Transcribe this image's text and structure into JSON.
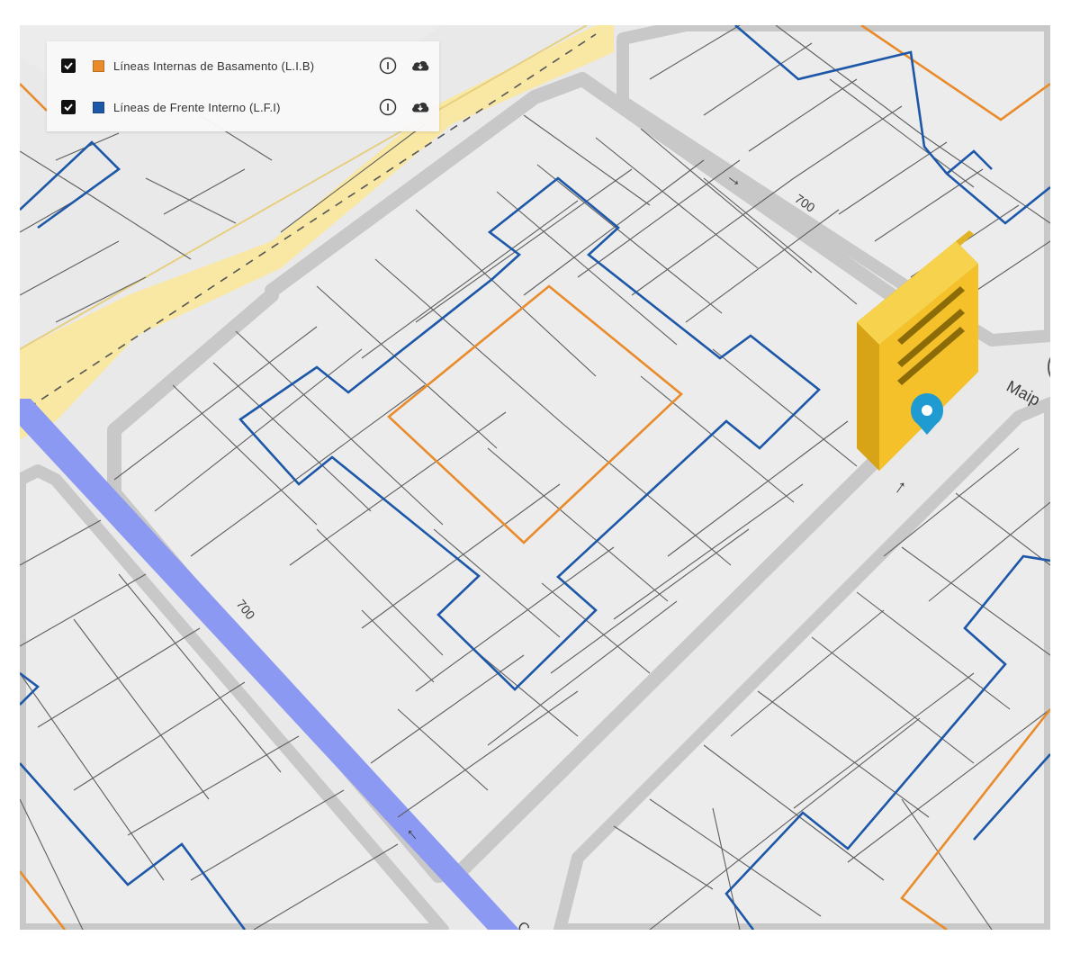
{
  "legend": {
    "layers": [
      {
        "label": "Líneas Internas de Basamento (L.I.B)",
        "checked": true,
        "color": "#e98b2a",
        "info_icon": "info-icon",
        "download_icon": "cloud-download-icon"
      },
      {
        "label": "Líneas de Frente Interno (L.F.I)",
        "checked": true,
        "color": "#1d57a8",
        "info_icon": "info-icon",
        "download_icon": "cloud-download-icon"
      }
    ]
  },
  "map": {
    "street_labels": {
      "street_number_upper": "700",
      "street_number_lower": "700",
      "street_name": "Maip",
      "avenue_partial": "C"
    },
    "arrows": {
      "upper_street": "→",
      "lower_street": "→",
      "avenue": "→"
    },
    "marker_icon": "location-pin-icon",
    "building": "3d-building",
    "colors": {
      "background": "#e9e9ea",
      "parcel_fill": "#ececec",
      "parcel_line": "#5e5e5e",
      "street": "#ffffff",
      "curb": "#c9c9c9",
      "avenue_yellow": "#f9e7a4",
      "avenue_blue": "#8c99f2",
      "lib_line": "#e98b2a",
      "lfi_line": "#1d57a8",
      "building_yellow": "#f4c12a",
      "marker": "#1f9bd1"
    }
  }
}
